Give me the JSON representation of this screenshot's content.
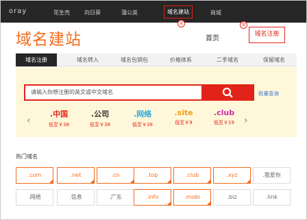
{
  "topnav": {
    "logo": "oray",
    "items": [
      {
        "label": "花生壳"
      },
      {
        "label": "向日葵"
      },
      {
        "label": "蒲公英"
      },
      {
        "label": "域名建站"
      },
      {
        "label": "商城"
      }
    ]
  },
  "annotations": [
    "①",
    "②"
  ],
  "header": {
    "title": "域名建站",
    "home": "首页",
    "register": "域名注册"
  },
  "tabs": [
    {
      "label": "域名注册"
    },
    {
      "label": "域名转入"
    },
    {
      "label": "域名包销包"
    },
    {
      "label": "价格体系"
    },
    {
      "label": "二手域名"
    },
    {
      "label": "保留域名"
    }
  ],
  "search": {
    "placeholder": "请输入你想注册的英文或中文域名",
    "bulk": "批量查询"
  },
  "promos": [
    {
      "ext": ".中国",
      "price": "低至￥38",
      "color": "#e2231a"
    },
    {
      "ext": ".公司",
      "price": "低至￥38",
      "color": "#333333"
    },
    {
      "ext": ".网络",
      "price": "低至￥38",
      "color": "#2fa8d8"
    },
    {
      "ext": ".site",
      "price": "低至￥9",
      "color": "#f39c12"
    },
    {
      "ext": ".club",
      "price": "低至￥19",
      "color": "#cc2fa5"
    }
  ],
  "hot": {
    "title": "热门域名",
    "row1": [
      {
        "label": ".com",
        "hl": true
      },
      {
        "label": ".net",
        "hl": true
      },
      {
        "label": ".cn",
        "hl": true
      },
      {
        "label": ".top",
        "hl": true
      },
      {
        "label": ".club",
        "hl": true
      },
      {
        "label": ".xyz",
        "hl": true
      },
      {
        "label": ".我爱你",
        "hl": false
      }
    ],
    "row2": [
      {
        "label": ".网络",
        "hl": false
      },
      {
        "label": ".信息",
        "hl": false
      },
      {
        "label": ".广东",
        "hl": false
      },
      {
        "label": ".info",
        "hl": true
      },
      {
        "label": ".mobi",
        "hl": true
      },
      {
        "label": ".biz",
        "hl": false
      },
      {
        "label": ".link",
        "hl": false
      }
    ]
  }
}
